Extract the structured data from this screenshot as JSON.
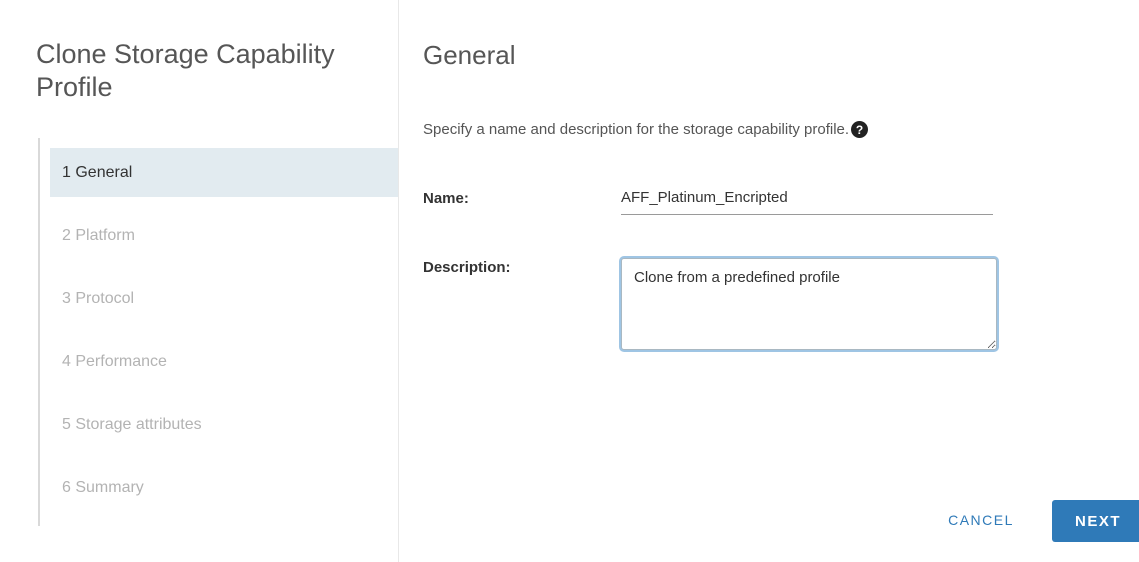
{
  "wizard": {
    "title": "Clone Storage Capability Profile",
    "steps": [
      {
        "label": "1 General",
        "active": true
      },
      {
        "label": "2 Platform",
        "active": false
      },
      {
        "label": "3 Protocol",
        "active": false
      },
      {
        "label": "4 Performance",
        "active": false
      },
      {
        "label": "5 Storage attributes",
        "active": false
      },
      {
        "label": "6 Summary",
        "active": false
      }
    ]
  },
  "page": {
    "title": "General",
    "instruction": "Specify a name and description for the storage capability profile.",
    "help_icon": "question-circle-icon",
    "help_glyph": "?"
  },
  "form": {
    "name_label": "Name:",
    "name_value": "AFF_Platinum_Encripted",
    "description_label": "Description:",
    "description_value": "Clone from a predefined profile"
  },
  "actions": {
    "cancel_label": "CANCEL",
    "next_label": "NEXT"
  },
  "colors": {
    "accent": "#2f7ab8",
    "active_step_bg": "#e2ebf0",
    "inactive_step_text": "#b3b3b3"
  }
}
